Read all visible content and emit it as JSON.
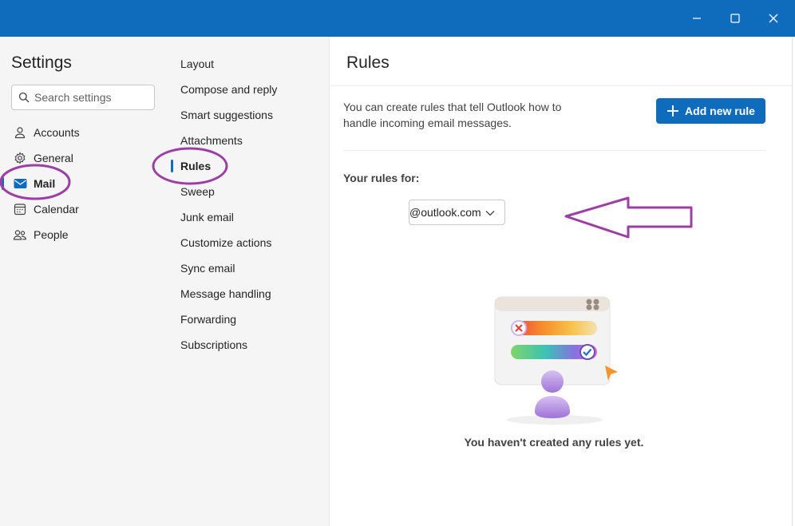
{
  "window": {
    "accent_color": "#0f6cbd",
    "controls": [
      "minimize-icon",
      "maximize-icon",
      "close-icon"
    ]
  },
  "settings": {
    "title": "Settings",
    "search_placeholder": "Search settings",
    "items": [
      {
        "label": "Accounts",
        "icon": "person-icon"
      },
      {
        "label": "General",
        "icon": "gear-icon"
      },
      {
        "label": "Mail",
        "icon": "mail-icon",
        "active": true
      },
      {
        "label": "Calendar",
        "icon": "calendar-icon"
      },
      {
        "label": "People",
        "icon": "people-icon"
      }
    ]
  },
  "mail_categories": {
    "items": [
      {
        "label": "Layout"
      },
      {
        "label": "Compose and reply"
      },
      {
        "label": "Smart suggestions"
      },
      {
        "label": "Attachments"
      },
      {
        "label": "Rules",
        "active": true
      },
      {
        "label": "Sweep"
      },
      {
        "label": "Junk email"
      },
      {
        "label": "Customize actions"
      },
      {
        "label": "Sync email"
      },
      {
        "label": "Message handling"
      },
      {
        "label": "Forwarding"
      },
      {
        "label": "Subscriptions"
      }
    ]
  },
  "rules": {
    "title": "Rules",
    "description": "You can create rules that tell Outlook how to handle incoming email messages.",
    "add_button_label": "Add new rule",
    "rules_for_label": "Your rules for:",
    "account_value": "@outlook.com",
    "empty_message": "You haven't created any rules yet."
  },
  "annotations": {
    "color": "#9b3fa5",
    "marks": [
      "circle-around-mail",
      "circle-around-rules",
      "arrow-pointing-to-account-dropdown"
    ]
  }
}
